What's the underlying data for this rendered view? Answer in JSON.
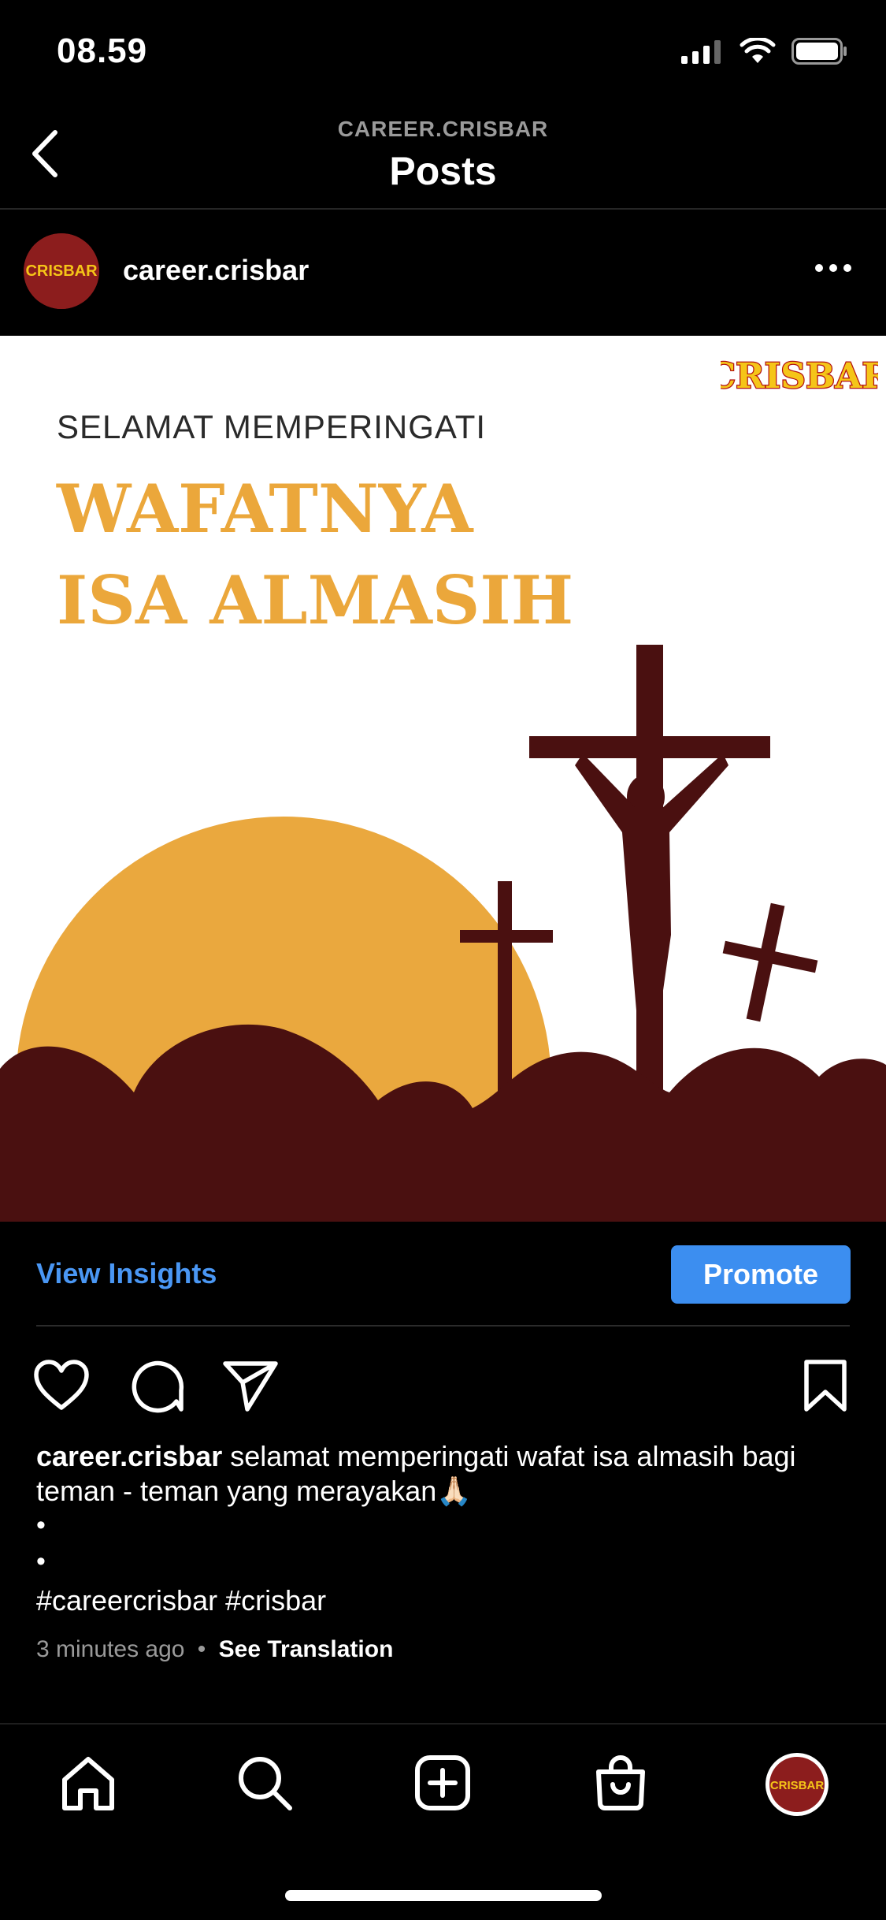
{
  "status_bar": {
    "time": "08.59"
  },
  "header": {
    "account": "CAREER.CRISBAR",
    "title": "Posts"
  },
  "post": {
    "username": "career.crisbar",
    "image": {
      "logo_text": "CRISBAR",
      "subtitle": "SELAMAT MEMPERINGATI",
      "title_line1": "WAFATNYA",
      "title_line2": "ISA ALMASIH"
    },
    "insights_label": "View Insights",
    "promote_label": "Promote",
    "caption_user": "career.crisbar",
    "caption_text": " selamat memperingati wafat isa almasih bagi teman - teman yang merayakan🙏🏻",
    "dot1": "•",
    "dot2": "•",
    "hashtags": "#careercrisbar #crisbar",
    "time_ago": "3 minutes ago",
    "separator": "•",
    "see_translation": "See Translation"
  },
  "colors": {
    "accent": "#3c8ef0",
    "title_orange": "#eba73b",
    "hill": "#4a1010"
  },
  "icons": [
    "back-chevron-icon",
    "more-icon",
    "heart-icon",
    "comment-icon",
    "share-icon",
    "bookmark-icon",
    "home-icon",
    "search-icon",
    "create-icon",
    "shop-icon",
    "profile-avatar-icon"
  ]
}
